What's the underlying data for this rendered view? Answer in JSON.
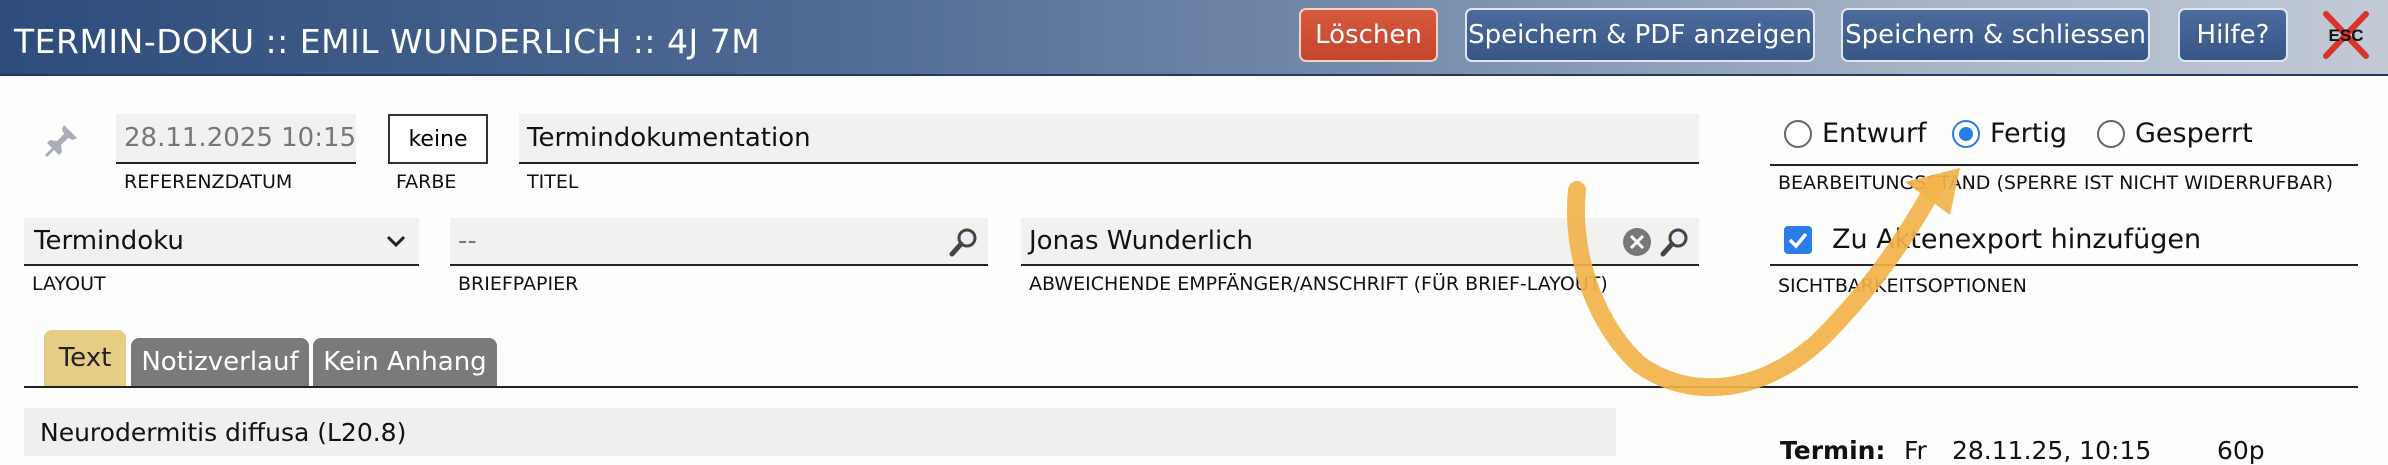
{
  "header": {
    "title": "TERMIN-DOKU :: EMIL WUNDERLICH :: 4J 7M",
    "buttons": {
      "delete": "Löschen",
      "save_pdf": "Speichern & PDF anzeigen",
      "save_close": "Speichern & schliessen",
      "help": "Hilfe?"
    },
    "esc_label": "ESC"
  },
  "form": {
    "reference_date": {
      "value": "28.11.2025 10:15",
      "label": "REFERENZDATUM"
    },
    "color": {
      "value": "keine",
      "label": "FARBE"
    },
    "title": {
      "value": "Termindokumentation",
      "label": "TITEL"
    },
    "layout": {
      "value": "Termindoku",
      "label": "LAYOUT"
    },
    "letterhead": {
      "value": "--",
      "label": "BRIEFPAPIER"
    },
    "recipient": {
      "value": "Jonas Wunderlich",
      "label": "ABWEICHENDE EMPFÄNGER/ANSCHRIFT (FÜR BRIEF-LAYOUT)"
    },
    "status": {
      "options": [
        "Entwurf",
        "Fertig",
        "Gesperrt"
      ],
      "selected": "Fertig",
      "label": "BEARBEITUNGSSTAND (SPERRE IST NICHT WIDERRUFBAR)"
    },
    "visibility": {
      "checkbox_label": "Zu Aktenexport hinzufügen",
      "checked": true,
      "label": "SICHTBARKEITSOPTIONEN"
    }
  },
  "tabs": [
    {
      "label": "Text",
      "active": true
    },
    {
      "label": "Notizverlauf",
      "active": false
    },
    {
      "label": "Kein Anhang",
      "active": false
    }
  ],
  "content": {
    "diagnosis": "Neurodermitis diffusa (L20.8)",
    "appointment": {
      "label": "Termin:",
      "day": "Fr",
      "datetime": "28.11.25, 10:15",
      "duration": "60p"
    }
  },
  "colors": {
    "header_dark": "#2e4c7c",
    "delete_button": "#c9502f",
    "primary_button": "#3d5c8c",
    "radio_accent": "#2b7de9",
    "active_tab": "#e6cd83",
    "inactive_tab": "#7a7a78",
    "annotation_arrow": "#f2b34a"
  },
  "icons": [
    "pin-icon",
    "chevron-down-icon",
    "magnifier-icon",
    "clear-icon",
    "esc-close-icon"
  ]
}
